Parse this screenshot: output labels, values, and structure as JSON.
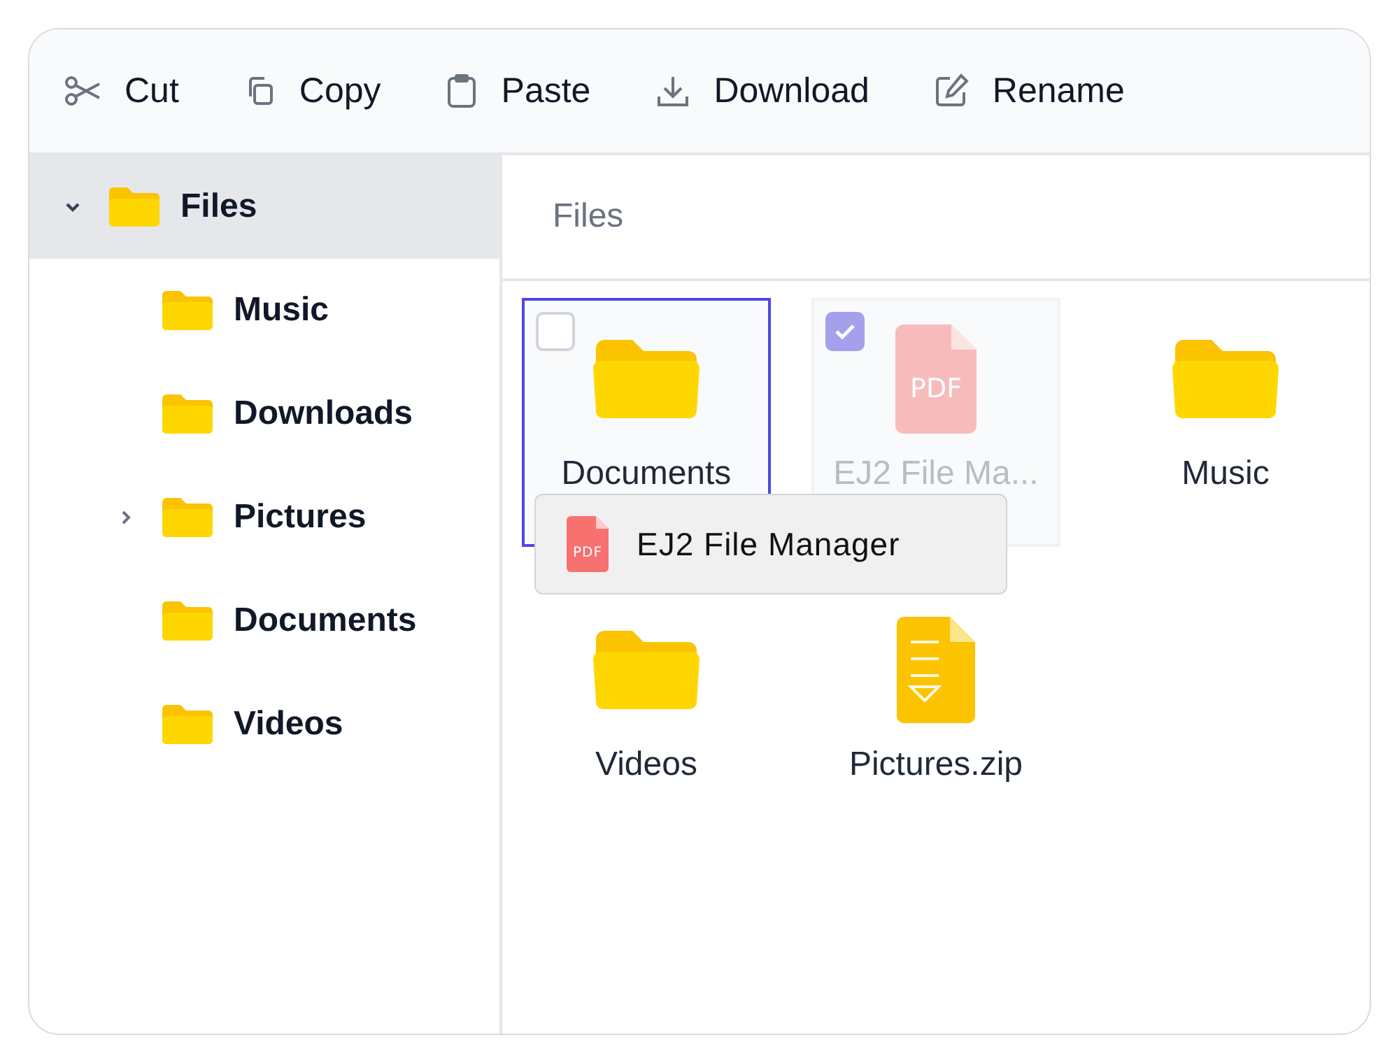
{
  "toolbar": [
    {
      "label": "Cut",
      "kind": "cut"
    },
    {
      "label": "Copy",
      "kind": "copy"
    },
    {
      "label": "Paste",
      "kind": "paste"
    },
    {
      "label": "Download",
      "kind": "download"
    },
    {
      "label": "Rename",
      "kind": "rename"
    }
  ],
  "tree": [
    {
      "label": "Files",
      "selected": true,
      "expanded": true,
      "expandable": true,
      "children": [
        {
          "label": "Music",
          "selected": false,
          "expanded": false,
          "expandable": false
        },
        {
          "label": "Downloads",
          "selected": false,
          "expanded": false,
          "expandable": false
        },
        {
          "label": "Pictures",
          "selected": false,
          "expanded": false,
          "expandable": true
        },
        {
          "label": "Documents",
          "selected": false,
          "expanded": false,
          "expandable": false
        },
        {
          "label": "Videos",
          "selected": false,
          "expanded": false,
          "expandable": false
        }
      ]
    }
  ],
  "breadcrumb": "Files",
  "items": [
    {
      "name": "Documents",
      "kind": "folder",
      "selected": false,
      "hovered": true,
      "dragging": false
    },
    {
      "name": "EJ2 File Ma...",
      "kind": "pdf",
      "icon_text": "PDF",
      "selected": true,
      "hovered": false,
      "dragging": true
    },
    {
      "name": "Music",
      "kind": "folder",
      "selected": false,
      "hovered": false,
      "dragging": false
    },
    {
      "name": "Videos",
      "kind": "folder",
      "selected": false,
      "hovered": false,
      "dragging": false
    },
    {
      "name": "Pictures.zip",
      "kind": "zip",
      "selected": false,
      "hovered": false,
      "dragging": false
    }
  ],
  "drag_preview": {
    "label": "EJ2 File Manager",
    "kind": "pdf",
    "icon_text": "PDF"
  }
}
